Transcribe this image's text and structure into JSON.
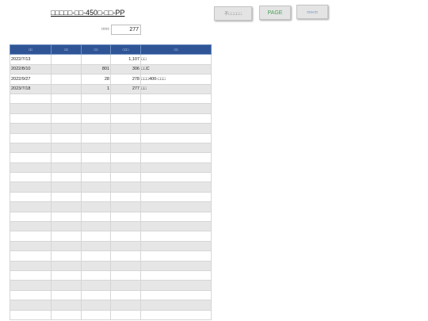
{
  "header": {
    "title": "□□□□□-□□-450□-□□-PP",
    "buttons": [
      {
        "label": "不□□□□□"
      },
      {
        "label": "PAGE"
      },
      {
        "label": "□□+□□"
      }
    ],
    "count_label": "□□□:",
    "count_value": "277"
  },
  "table": {
    "columns": [
      "□□",
      "□□",
      "□□",
      "□□□",
      "□□"
    ],
    "rows": [
      [
        "2022/7/13",
        "",
        "",
        "1,107",
        "□□"
      ],
      [
        "2022/8/10",
        "",
        "801",
        "306",
        "□□C"
      ],
      [
        "2022/9/27",
        "",
        "28",
        "278",
        "□□□400-□□□"
      ],
      [
        "2023/7/18",
        "",
        "1",
        "277",
        "□□"
      ],
      [
        "",
        "",
        "",
        "",
        ""
      ],
      [
        "",
        "",
        "",
        "",
        ""
      ],
      [
        "",
        "",
        "",
        "",
        ""
      ],
      [
        "",
        "",
        "",
        "",
        ""
      ],
      [
        "",
        "",
        "",
        "",
        ""
      ],
      [
        "",
        "",
        "",
        "",
        ""
      ],
      [
        "",
        "",
        "",
        "",
        ""
      ],
      [
        "",
        "",
        "",
        "",
        ""
      ],
      [
        "",
        "",
        "",
        "",
        ""
      ],
      [
        "",
        "",
        "",
        "",
        ""
      ],
      [
        "",
        "",
        "",
        "",
        ""
      ],
      [
        "",
        "",
        "",
        "",
        ""
      ],
      [
        "",
        "",
        "",
        "",
        ""
      ],
      [
        "",
        "",
        "",
        "",
        ""
      ],
      [
        "",
        "",
        "",
        "",
        ""
      ],
      [
        "",
        "",
        "",
        "",
        ""
      ],
      [
        "",
        "",
        "",
        "",
        ""
      ],
      [
        "",
        "",
        "",
        "",
        ""
      ],
      [
        "",
        "",
        "",
        "",
        ""
      ],
      [
        "",
        "",
        "",
        "",
        ""
      ],
      [
        "",
        "",
        "",
        "",
        ""
      ],
      [
        "",
        "",
        "",
        "",
        ""
      ],
      [
        "",
        "",
        "",
        "",
        ""
      ]
    ]
  }
}
